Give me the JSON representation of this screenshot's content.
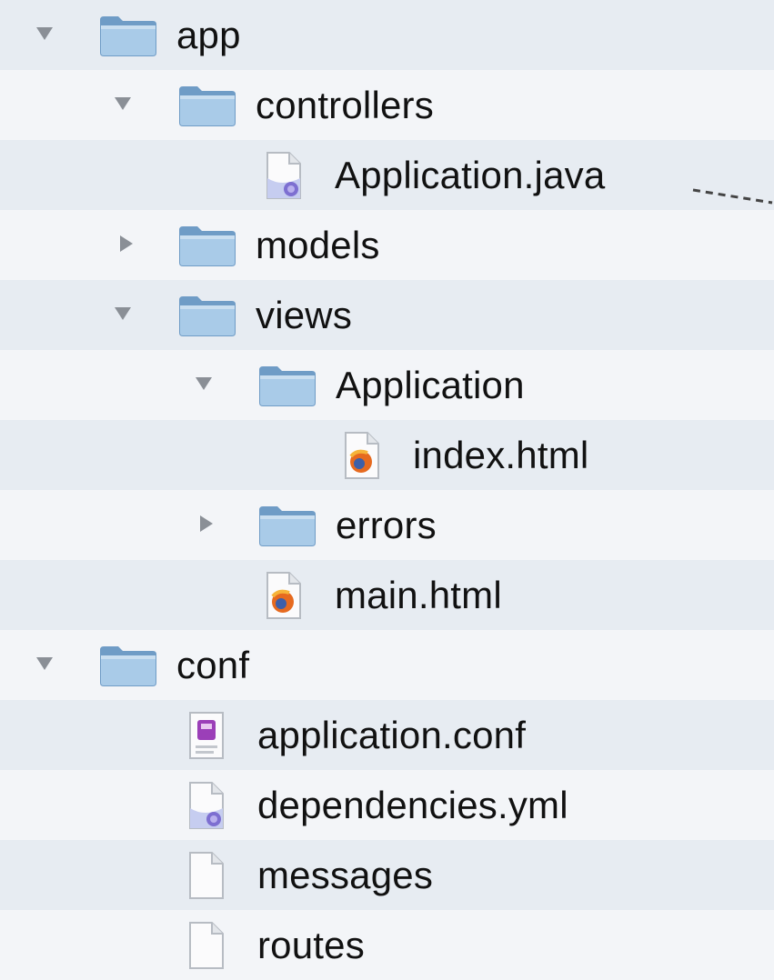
{
  "tree": [
    {
      "label": "app",
      "kind": "folder",
      "expanded": true,
      "depth": 0
    },
    {
      "label": "controllers",
      "kind": "folder",
      "expanded": true,
      "depth": 1
    },
    {
      "label": "Application.java",
      "kind": "java-file",
      "depth": 2
    },
    {
      "label": "models",
      "kind": "folder",
      "expanded": false,
      "depth": 1
    },
    {
      "label": "views",
      "kind": "folder",
      "expanded": true,
      "depth": 1
    },
    {
      "label": "Application",
      "kind": "folder",
      "expanded": true,
      "depth": 2
    },
    {
      "label": "index.html",
      "kind": "html-file",
      "depth": 3
    },
    {
      "label": "errors",
      "kind": "folder",
      "expanded": false,
      "depth": 2
    },
    {
      "label": "main.html",
      "kind": "html-file",
      "depth": 2
    },
    {
      "label": "conf",
      "kind": "folder",
      "expanded": true,
      "depth": 0
    },
    {
      "label": "application.conf",
      "kind": "conf-file",
      "depth": 1
    },
    {
      "label": "dependencies.yml",
      "kind": "yml-file",
      "depth": 1
    },
    {
      "label": "messages",
      "kind": "plain-file",
      "depth": 1
    },
    {
      "label": "routes",
      "kind": "plain-file",
      "depth": 1
    }
  ],
  "icons": {
    "folder": "folder-icon",
    "java-file": "java-file-icon",
    "html-file": "html-file-icon",
    "conf-file": "conf-file-icon",
    "yml-file": "yml-file-icon",
    "plain-file": "document-icon",
    "expanded": "disclosure-triangle-down-icon",
    "collapsed": "disclosure-triangle-right-icon"
  },
  "colors": {
    "folder_body": "#9fc2e0",
    "row_alternate": "#f3f5f8",
    "row_base": "#e7ecf2",
    "triangle": "#8a8f96"
  }
}
